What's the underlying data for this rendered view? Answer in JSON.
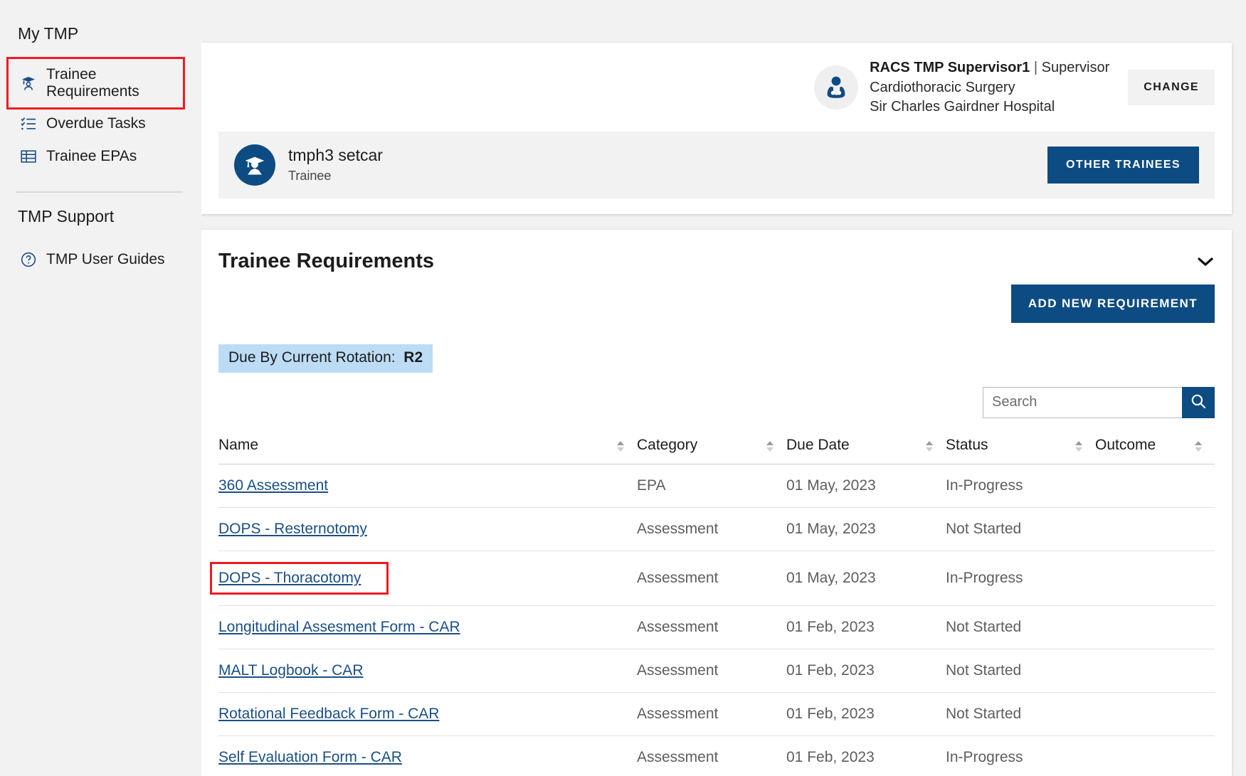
{
  "sidebar": {
    "section_my": "My TMP",
    "section_support": "TMP Support",
    "items": [
      {
        "label": "Trainee Requirements",
        "icon": "graduate-icon",
        "highlighted": true
      },
      {
        "label": "Overdue Tasks",
        "icon": "checklist-icon",
        "highlighted": false
      },
      {
        "label": "Trainee EPAs",
        "icon": "table-grid-icon",
        "highlighted": false
      }
    ],
    "support_items": [
      {
        "label": "TMP User Guides",
        "icon": "question-circle-icon"
      }
    ]
  },
  "user": {
    "name": "RACS TMP Supervisor1",
    "separator": "|",
    "role": "Supervisor",
    "specialty": "Cardiothoracic Surgery",
    "hospital": "Sir Charles Gairdner Hospital",
    "change_label": "CHANGE",
    "avatar_icon": "doctor-stethoscope-icon"
  },
  "trainee": {
    "name": "tmph3 setcar",
    "role": "Trainee",
    "other_trainees_label": "OTHER TRAINEES",
    "avatar_icon": "graduate-person-icon"
  },
  "requirements": {
    "title": "Trainee Requirements",
    "add_label": "ADD NEW REQUIREMENT",
    "chip_label": "Due By Current Rotation:",
    "chip_value": "R2",
    "search_placeholder": "Search",
    "search_value": "",
    "columns": [
      "Name",
      "Category",
      "Due Date",
      "Status",
      "Outcome"
    ],
    "rows": [
      {
        "name": "360 Assessment",
        "category": "EPA",
        "due": "01 May, 2023",
        "status": "In-Progress",
        "outcome": "",
        "boxed": false
      },
      {
        "name": "DOPS - Resternotomy",
        "category": "Assessment",
        "due": "01 May, 2023",
        "status": "Not Started",
        "outcome": "",
        "boxed": false
      },
      {
        "name": "DOPS - Thoracotomy",
        "category": "Assessment",
        "due": "01 May, 2023",
        "status": "In-Progress",
        "outcome": "",
        "boxed": true
      },
      {
        "name": "Longitudinal Assesment Form - CAR",
        "category": "Assessment",
        "due": "01 Feb, 2023",
        "status": "Not Started",
        "outcome": "",
        "boxed": false
      },
      {
        "name": "MALT Logbook - CAR",
        "category": "Assessment",
        "due": "01 Feb, 2023",
        "status": "Not Started",
        "outcome": "",
        "boxed": false
      },
      {
        "name": "Rotational Feedback Form - CAR",
        "category": "Assessment",
        "due": "01 Feb, 2023",
        "status": "Not Started",
        "outcome": "",
        "boxed": false
      },
      {
        "name": "Self Evaluation Form - CAR",
        "category": "Assessment",
        "due": "01 Feb, 2023",
        "status": "In-Progress",
        "outcome": "",
        "boxed": false
      }
    ]
  },
  "colors": {
    "brand_blue": "#0d4c82",
    "link_blue": "#1b4f84",
    "highlight_red": "#ee1b22",
    "chip_blue": "#bcdcf6",
    "page_bg": "#f2f2f2"
  }
}
